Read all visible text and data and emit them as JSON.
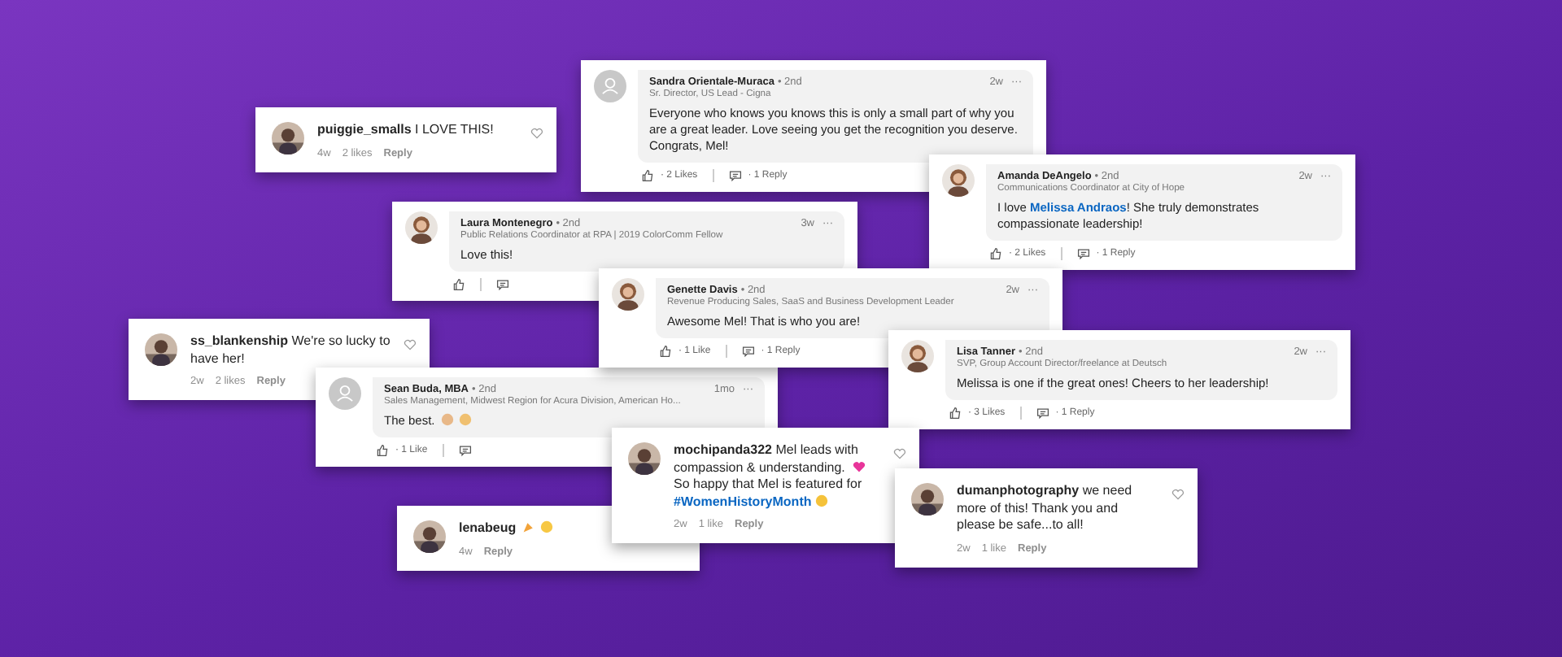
{
  "comments": [
    {
      "kind": "instagram",
      "user": "puiggie_smalls",
      "segments": [
        {
          "kind": "text",
          "text": "I LOVE THIS!"
        }
      ],
      "time": "4w",
      "likes": "2 likes",
      "reply": "Reply",
      "like_icon": true
    },
    {
      "kind": "linkedin",
      "avatar": {
        "kind": "default"
      },
      "name": "Sandra Orientale-Muraca",
      "degree": "• 2nd",
      "headline": "Sr. Director, US Lead - Cigna",
      "time": "2w",
      "more": "···",
      "segments": [
        {
          "kind": "text",
          "text": "Everyone who knows you knows this is only a small part of why you are a great leader.  Love seeing you get the recognition you deserve. Congrats, Mel!"
        }
      ],
      "likes": "· 2 Likes",
      "replies": "· 1 Reply"
    },
    {
      "kind": "linkedin",
      "avatar": {
        "kind": "picture"
      },
      "name": "Laura Montenegro",
      "degree": "• 2nd",
      "headline": "Public Relations Coordinator at RPA | 2019 ColorComm Fellow",
      "time": "3w",
      "more": "···",
      "segments": [
        {
          "kind": "text",
          "text": "Love this!"
        }
      ]
    },
    {
      "kind": "linkedin",
      "avatar": {
        "kind": "picture"
      },
      "name": "Amanda DeAngelo",
      "degree": "• 2nd",
      "headline": "Communications Coordinator at City of Hope",
      "time": "2w",
      "more": "···",
      "segments": [
        {
          "kind": "text",
          "text": "I love "
        },
        {
          "kind": "link",
          "text": "Melissa Andraos"
        },
        {
          "kind": "text",
          "text": "! She truly demonstrates compassionate leadership!"
        }
      ],
      "likes": "· 2 Likes",
      "replies": "· 1 Reply"
    },
    {
      "kind": "instagram",
      "user": "ss_blankenship",
      "segments": [
        {
          "kind": "text",
          "text": "We're so lucky to have her!"
        }
      ],
      "time": "2w",
      "likes": "2 likes",
      "reply": "Reply",
      "like_icon": true
    },
    {
      "kind": "linkedin",
      "avatar": {
        "kind": "picture"
      },
      "name": "Genette Davis",
      "degree": "• 2nd",
      "headline": "Revenue Producing Sales, SaaS and Business Development Leader",
      "time": "2w",
      "more": "···",
      "segments": [
        {
          "kind": "text",
          "text": "Awesome Mel! That is who you are!"
        }
      ],
      "likes": "· 1 Like",
      "replies": "· 1 Reply"
    },
    {
      "kind": "linkedin",
      "avatar": {
        "kind": "picture"
      },
      "name": "Lisa Tanner",
      "degree": "• 2nd",
      "headline": "SVP, Group Account Director/freelance at Deutsch",
      "time": "2w",
      "more": "···",
      "segments": [
        {
          "kind": "text",
          "text": "Melissa is one if the great ones! Cheers to her leadership!"
        }
      ],
      "likes": "· 3 Likes",
      "replies": "· 1 Reply"
    },
    {
      "kind": "linkedin",
      "avatar": {
        "kind": "default"
      },
      "name": "Sean Buda, MBA",
      "degree": "• 2nd",
      "headline": "Sales Management, Midwest Region for Acura Division, American Ho...",
      "time": "1mo",
      "more": "···",
      "segments": [
        {
          "kind": "text",
          "text": "The best. "
        },
        {
          "kind": "ok-emoji"
        },
        {
          "kind": "muscle-emoji"
        }
      ],
      "likes": "· 1 Like"
    },
    {
      "kind": "instagram",
      "user": "mochipanda322",
      "segments": [
        {
          "kind": "text",
          "text": "Mel leads with compassion & understanding. "
        },
        {
          "kind": "heart-emoji"
        },
        {
          "kind": "text",
          "text": " So happy that Mel is featured for "
        },
        {
          "kind": "link",
          "text": "#WomenHistoryMonth"
        },
        {
          "kind": "hug-emoji"
        }
      ],
      "time": "2w",
      "likes": "1 like",
      "reply": "Reply",
      "like_icon": true
    },
    {
      "kind": "instagram",
      "user": "lenabeug",
      "segments": [
        {
          "kind": "party-emoji"
        },
        {
          "kind": "smile-emoji"
        }
      ],
      "time": "4w",
      "reply": "Reply"
    },
    {
      "kind": "instagram",
      "user": "dumanphotography",
      "segments": [
        {
          "kind": "text",
          "text": "we need more of this! Thank you and please be safe...to all!"
        }
      ],
      "time": "2w",
      "likes": "1 like",
      "reply": "Reply",
      "like_icon": true
    }
  ]
}
